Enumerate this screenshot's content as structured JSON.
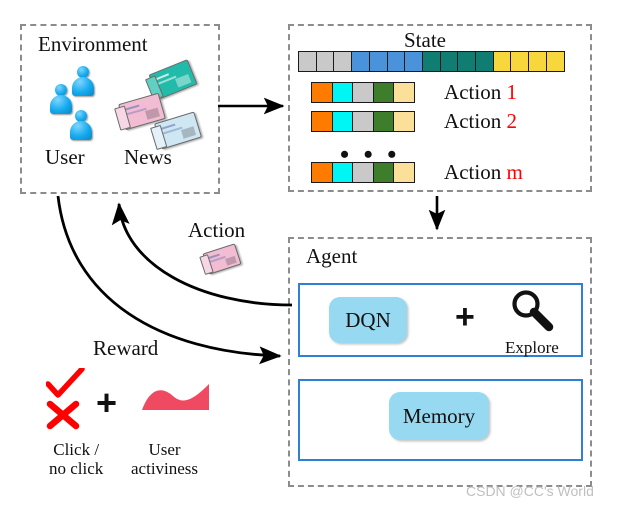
{
  "environment": {
    "title": "Environment",
    "user_label": "User",
    "news_label": "News",
    "people_count": 3,
    "news_count": 3,
    "news_colors": [
      "#1fb7a6",
      "#f0bcd2",
      "#cde4f2"
    ],
    "person_color": "#14a9ee"
  },
  "state_panel": {
    "title": "State",
    "state_cells": [
      "#c9c9c9",
      "#c9c9c9",
      "#c9c9c9",
      "#4a92d9",
      "#4a92d9",
      "#4a92d9",
      "#4a92d9",
      "#0f7d72",
      "#0f7d72",
      "#0f7d72",
      "#0f7d72",
      "#f8d73c",
      "#f8d73c",
      "#f8d73c",
      "#f8d73c"
    ],
    "action_cells": [
      "#ff7b00",
      "#00f5f5",
      "#c9c9c9",
      "#3e7d2a",
      "#fbe09a"
    ],
    "actions": [
      {
        "prefix": "Action ",
        "index": "1"
      },
      {
        "prefix": "Action ",
        "index": "2"
      },
      {
        "prefix": "Action ",
        "index": "m"
      }
    ],
    "ellipsis": "• • •"
  },
  "agent_panel": {
    "title": "Agent",
    "dqn_label": "DQN",
    "plus_symbol": "+",
    "explore_label": "Explore",
    "explore_icon": "magnifier-icon",
    "memory_label": "Memory",
    "accent_color": "#2f7fd6",
    "pill_color": "#97d9f0"
  },
  "flow": {
    "action_label": "Action",
    "reward_label": "Reward"
  },
  "reward": {
    "check_icon": "check-mark-icon",
    "x_icon": "x-mark-icon",
    "plus_symbol": "+",
    "wave_icon": "activity-wave-icon",
    "click_line1": "Click /",
    "click_line2": "no click",
    "activeness_line1": "User",
    "activeness_line2": "activiness",
    "mark_color": "#ff0000",
    "wave_color": "#f04a63"
  },
  "watermark": {
    "text": "CSDN @CC's World"
  }
}
